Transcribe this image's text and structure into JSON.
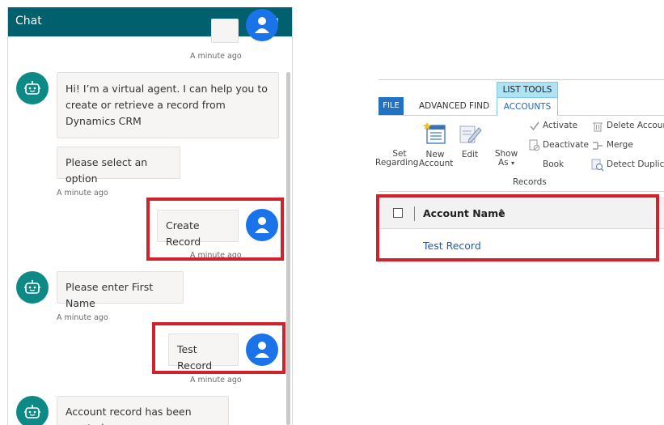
{
  "chat": {
    "title": "Chat",
    "messages": [
      {
        "text": "Hi! I’m a virtual agent. I can help you to create or retrieve a record from Dynamics CRM"
      },
      {
        "text": "Please select an option"
      },
      {
        "text": "Create Record"
      },
      {
        "text": "Please enter First Name"
      },
      {
        "text": "Test Record"
      },
      {
        "text": "Account record has been created."
      }
    ],
    "timestamps": [
      "A minute ago",
      "A minute ago",
      "A minute ago",
      "A minute ago",
      "A minute ago"
    ]
  },
  "crm": {
    "context_group": "LIST TOOLS",
    "tabs": {
      "file": "FILE",
      "advanced_find": "ADVANCED FIND",
      "accounts": "ACCOUNTS"
    },
    "ribbon": {
      "set_regarding_1": "Set",
      "set_regarding_2": "Regarding",
      "new_account_1": "New",
      "new_account_2": "Account",
      "edit": "Edit",
      "show_as_1": "Show",
      "show_as_2": "As",
      "activate": "Activate",
      "deactivate": "Deactivate",
      "book": "Book",
      "delete_account": "Delete Account",
      "merge": "Merge",
      "detect_duplicates": "Detect Duplicates",
      "group_label": "Records"
    },
    "grid": {
      "column": "Account Name",
      "sort_indicator": "↑",
      "rows": [
        "Test Record"
      ]
    }
  },
  "colors": {
    "chat_header": "#00606e",
    "bot_avatar": "#0e8a86",
    "user_avatar": "#1a73e8",
    "highlight": "#d0222a",
    "file_tab": "#2272c3"
  }
}
